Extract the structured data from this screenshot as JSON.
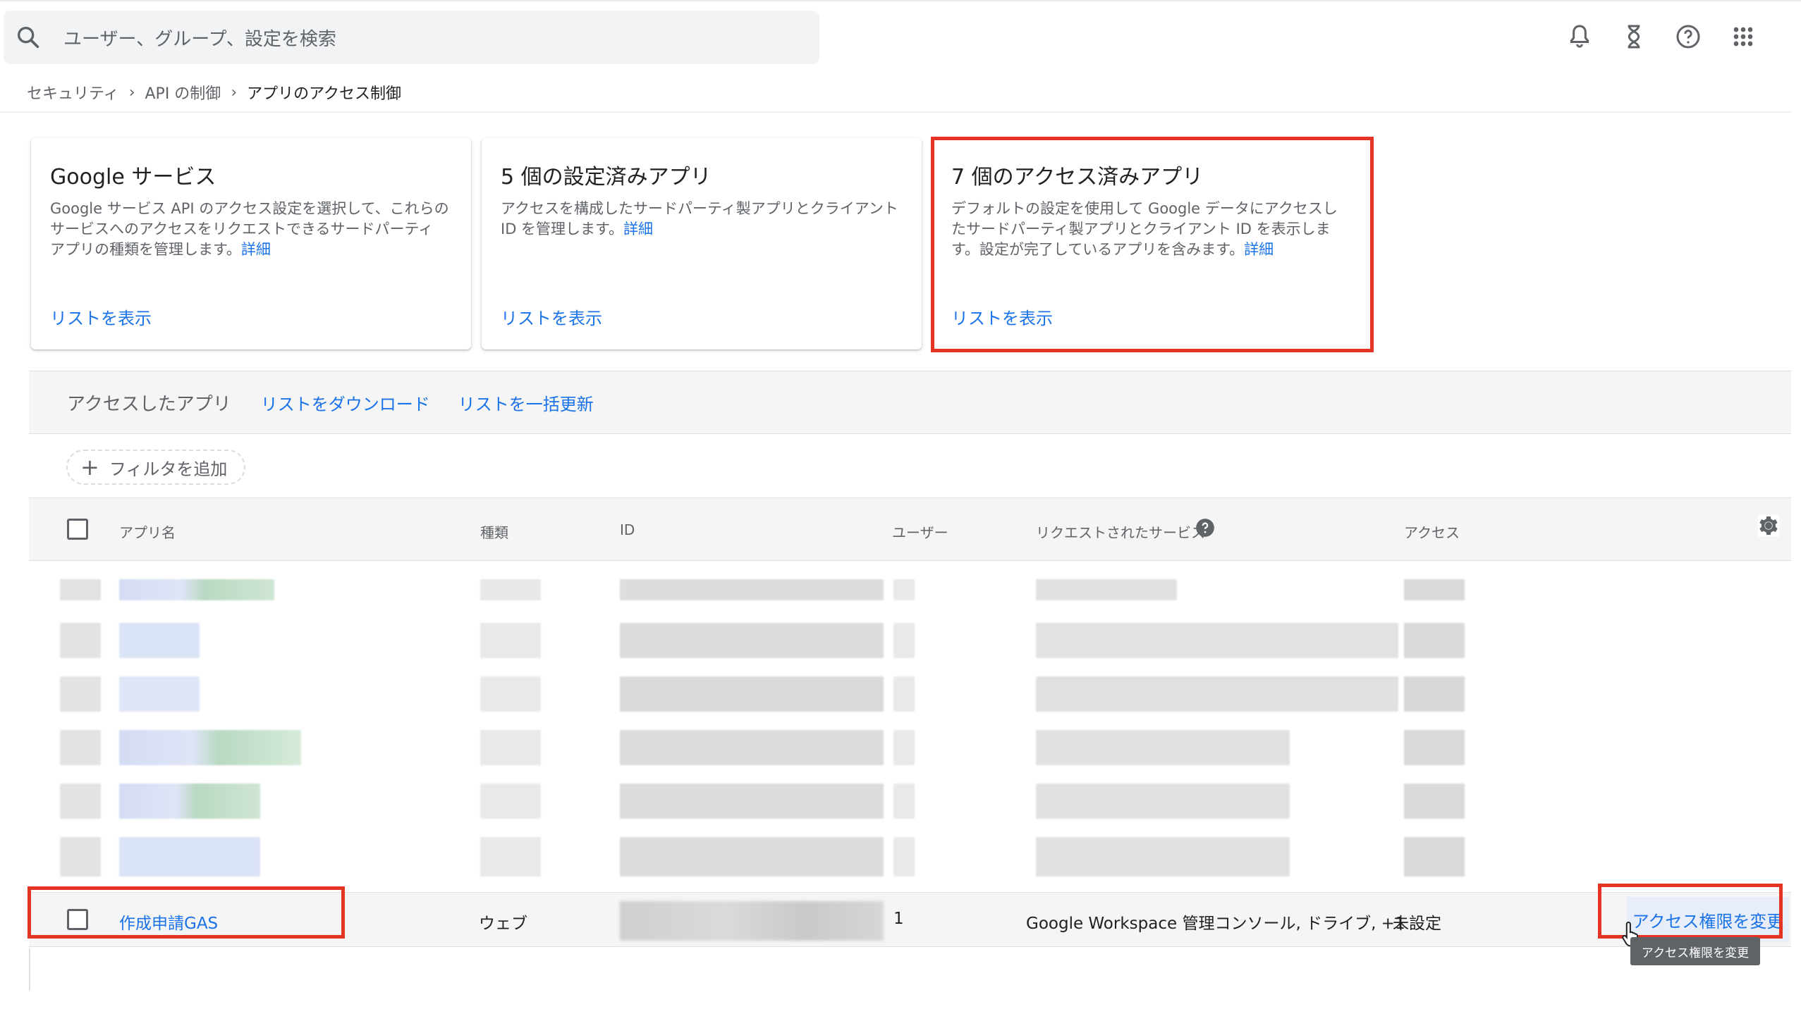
{
  "search": {
    "placeholder": "ユーザー、グループ、設定を検索"
  },
  "topbar_icons": [
    "bell-icon",
    "hourglass-icon",
    "help-circle-icon",
    "apps-grid-icon"
  ],
  "breadcrumb": {
    "items": [
      "セキュリティ",
      "API の制御",
      "アプリのアクセス制御"
    ],
    "separator": "›"
  },
  "cards": [
    {
      "title": "Google サービス",
      "description": "Google サービス API のアクセス設定を選択して、これらのサービスへのアクセスをリクエストできるサードパーティ アプリの種類を管理します。",
      "detail_link": "詳細",
      "action": "リストを表示"
    },
    {
      "title": "5 個の設定済みアプリ",
      "description": "アクセスを構成したサードパーティ製アプリとクライアント ID を管理します。",
      "detail_link": "詳細",
      "action": "リストを表示"
    },
    {
      "title": "7 個のアクセス済みアプリ",
      "description": "デフォルトの設定を使用して Google データにアクセスしたサードパーティ製アプリとクライアント ID を表示します。設定が完了しているアプリを含みます。",
      "detail_link": "詳細",
      "action": "リストを表示"
    }
  ],
  "toolbar": {
    "title": "アクセスしたアプリ",
    "download": "リストをダウンロード",
    "bulk_update": "リストを一括更新"
  },
  "filter": {
    "label": "フィルタを追加",
    "icon": "plus-icon"
  },
  "table": {
    "columns": [
      "アプリ名",
      "種類",
      "ID",
      "ユーザー",
      "リクエストされたサービス",
      "アクセス"
    ],
    "row": {
      "app_name": "作成申請GAS",
      "type": "ウェブ",
      "users": "1",
      "services": "Google Workspace 管理コンソール, ドライブ, +1",
      "access": "未設定",
      "action": "アクセス権限を変更"
    }
  },
  "tooltip": "アクセス権限を変更",
  "colors": {
    "accent": "#1a73e8",
    "highlight": "#e53424",
    "header_bg": "#f5f5f5"
  }
}
